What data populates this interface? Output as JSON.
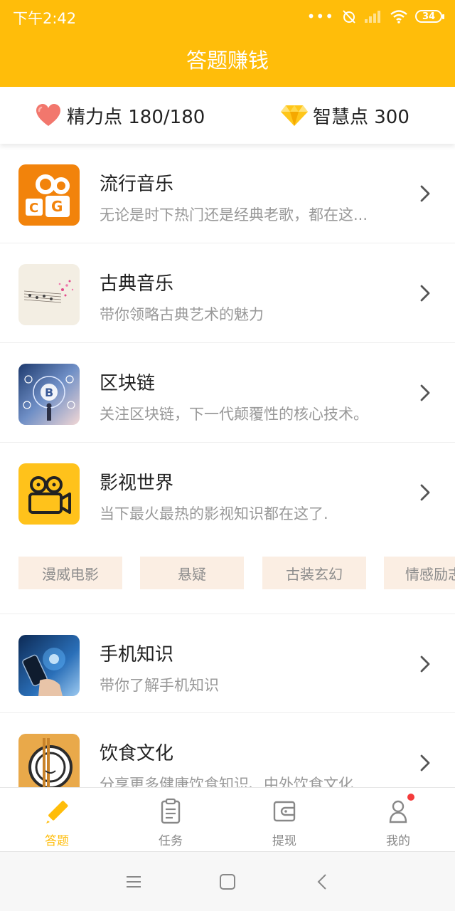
{
  "status": {
    "time": "下午2:42",
    "battery": "34"
  },
  "header": {
    "title": "答题赚钱"
  },
  "points": {
    "energy_label": "精力点 180/180",
    "wisdom_label": "智慧点 300"
  },
  "categories": [
    {
      "name": "流行音乐",
      "desc": "无论是时下热门还是经典老歌，都在这..."
    },
    {
      "name": "古典音乐",
      "desc": "带你领略古典艺术的魅力"
    },
    {
      "name": "区块链",
      "desc": "关注区块链，下一代颠覆性的核心技术。"
    },
    {
      "name": "影视世界",
      "desc": "当下最火最热的影视知识都在这了."
    },
    {
      "name": "手机知识",
      "desc": "带你了解手机知识"
    },
    {
      "name": "饮食文化",
      "desc": "分享更多健康饮食知识、中外饮食文化"
    }
  ],
  "tags": [
    "漫威电影",
    "悬疑",
    "古装玄幻",
    "情感励志"
  ],
  "tabs": [
    {
      "label": "答题",
      "icon": "pencil-icon",
      "active": true
    },
    {
      "label": "任务",
      "icon": "clipboard-icon",
      "active": false
    },
    {
      "label": "提现",
      "icon": "wallet-icon",
      "active": false
    },
    {
      "label": "我的",
      "icon": "person-icon",
      "active": false
    }
  ],
  "colors": {
    "accent": "#FFBD0A",
    "tag_bg": "#FBEEE3",
    "badge": "#F43B3B"
  }
}
